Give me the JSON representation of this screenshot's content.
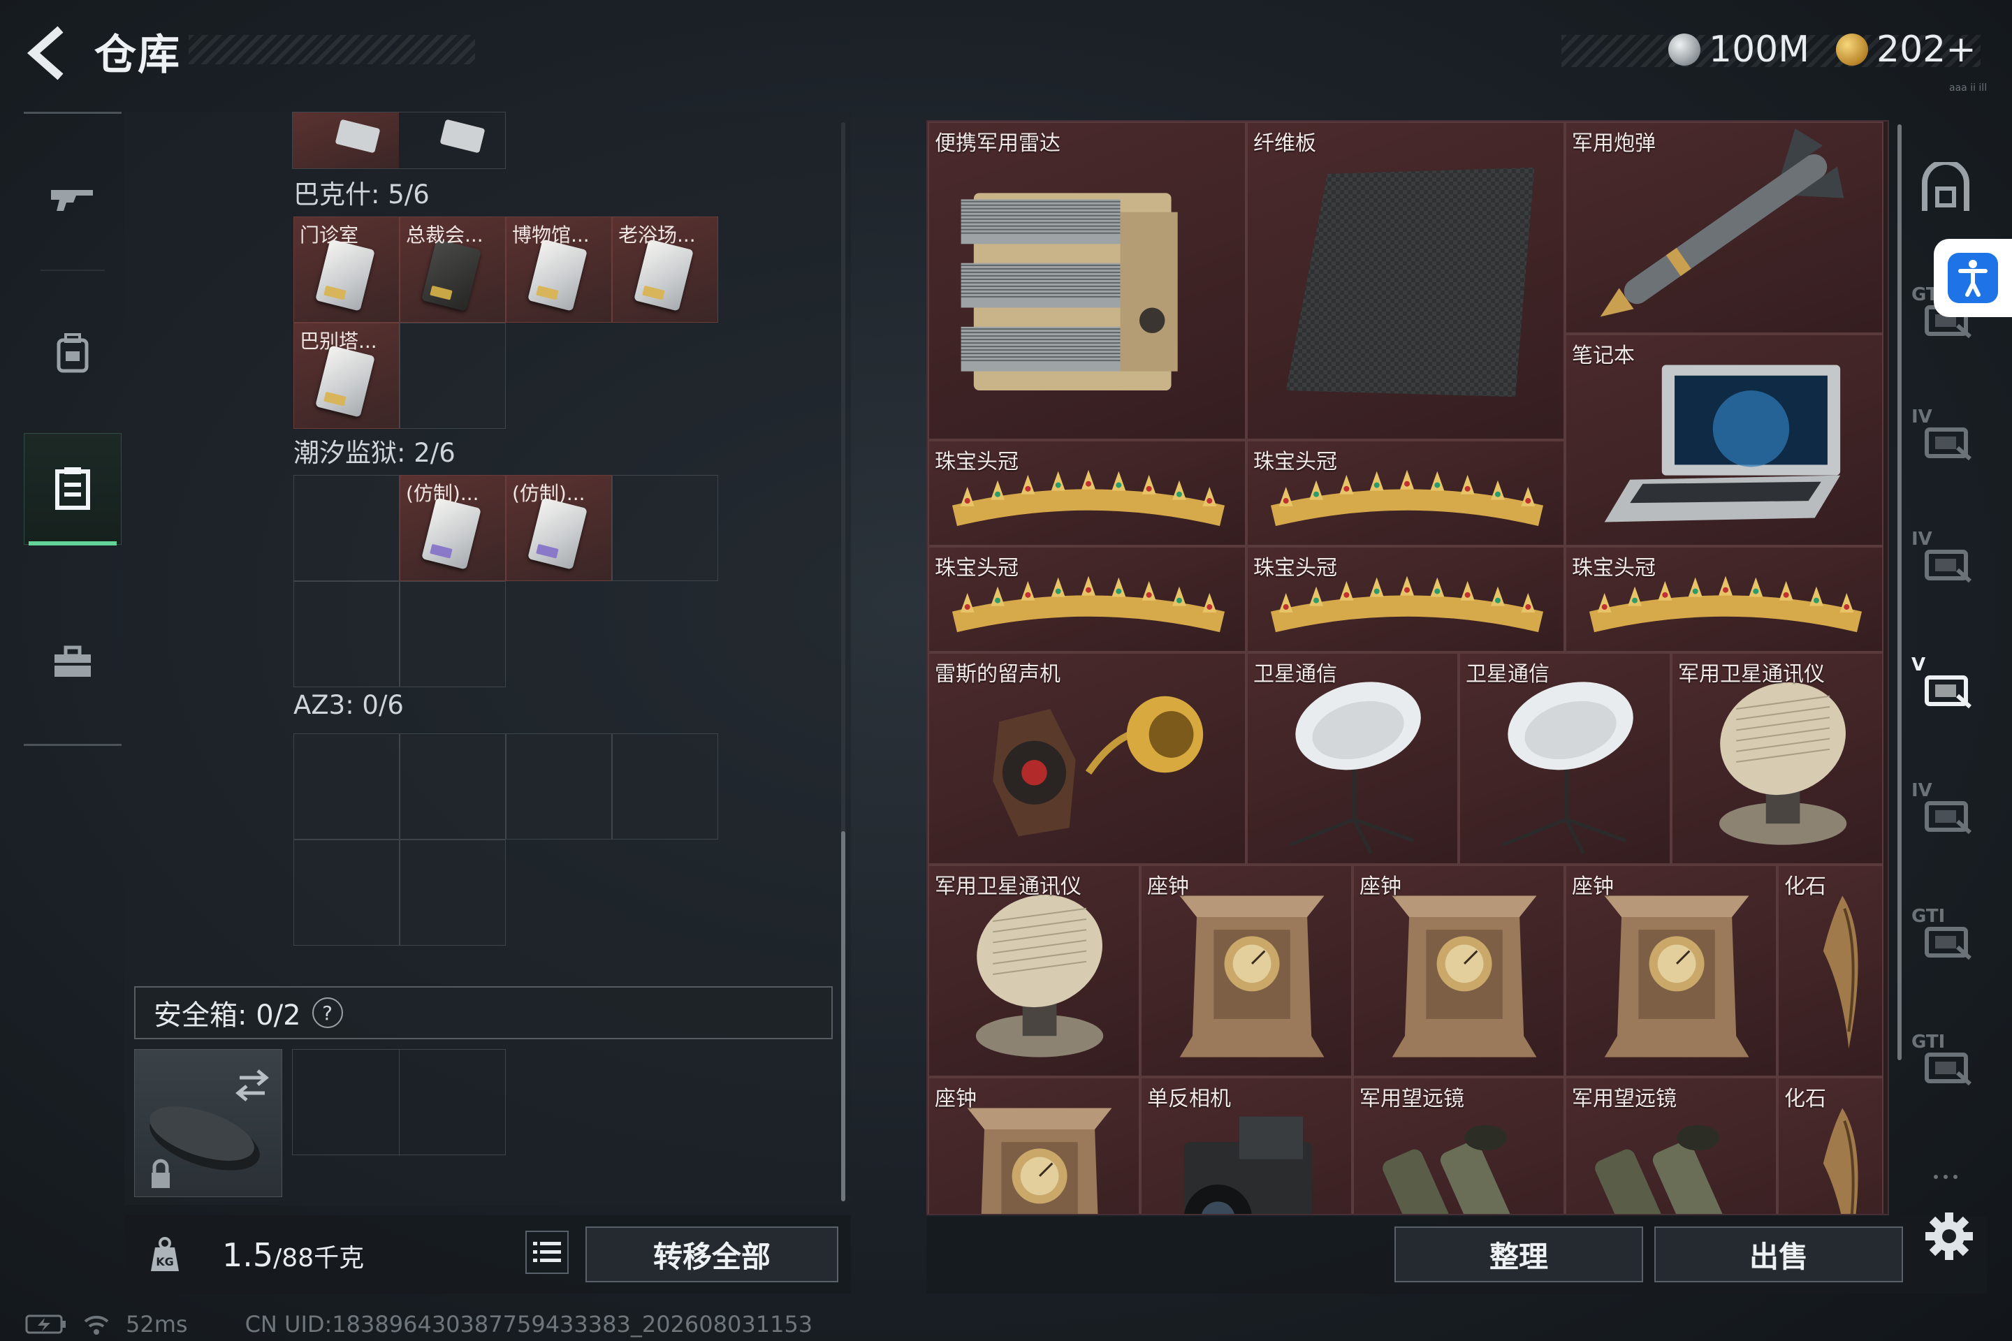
{
  "header": {
    "title": "仓库",
    "currencies": [
      {
        "value": "100M",
        "icon": "silver-coin-icon",
        "color": "#c9ced2"
      },
      {
        "value": "202+",
        "icon": "gold-triangle-coin-icon",
        "color": "#d8a840"
      }
    ],
    "id_text": "aaa ii ill"
  },
  "left_rail": {
    "items": [
      {
        "icon": "rifle-icon"
      },
      {
        "icon": "backpack-icon"
      },
      {
        "icon": "warehouse-locker-icon",
        "active": true
      },
      {
        "icon": "toolbox-icon"
      }
    ]
  },
  "keycards": {
    "sections": [
      {
        "label": "巴克什: 5/6",
        "cells": [
          {
            "name": "门诊室",
            "card": "white"
          },
          {
            "name": "总裁会...",
            "card": "black"
          },
          {
            "name": "博物馆...",
            "card": "white"
          },
          {
            "name": "老浴场...",
            "card": "white"
          },
          {
            "name": "巴别塔...",
            "card": "white"
          },
          {
            "name": "",
            "card": ""
          }
        ]
      },
      {
        "label": "潮汐监狱: 2/6",
        "cells": [
          {
            "name": "",
            "card": ""
          },
          {
            "name": "(仿制)...",
            "card": "purple"
          },
          {
            "name": "(仿制)...",
            "card": "purple"
          },
          {
            "name": "",
            "card": ""
          },
          {
            "name": "",
            "card": ""
          },
          {
            "name": "",
            "card": ""
          }
        ]
      },
      {
        "label": "AZ3: 0/6",
        "cells": [
          {
            "name": "",
            "card": ""
          },
          {
            "name": "",
            "card": ""
          },
          {
            "name": "",
            "card": ""
          },
          {
            "name": "",
            "card": ""
          },
          {
            "name": "",
            "card": ""
          },
          {
            "name": "",
            "card": ""
          }
        ]
      }
    ]
  },
  "safe_box": {
    "label": "安全箱:  0/2",
    "help": "?"
  },
  "weight": {
    "current": "1.5",
    "max": "/88千克"
  },
  "buttons": {
    "transfer_all": "转移全部",
    "sort": "整理",
    "sell": "出售"
  },
  "stash_items": [
    {
      "name": "便携军用雷达",
      "art": "radar"
    },
    {
      "name": "纤维板",
      "art": "carbon"
    },
    {
      "name": "军用炮弹",
      "art": "missile"
    },
    {
      "name": "笔记本",
      "art": "laptop"
    },
    {
      "name": "珠宝头冠",
      "art": "tiara"
    },
    {
      "name": "珠宝头冠",
      "art": "tiara"
    },
    {
      "name": "珠宝头冠",
      "art": "tiara"
    },
    {
      "name": "珠宝头冠",
      "art": "tiara"
    },
    {
      "name": "珠宝头冠",
      "art": "tiara"
    },
    {
      "name": "雷斯的留声机",
      "art": "gramophone"
    },
    {
      "name": "卫星通信",
      "art": "dish"
    },
    {
      "name": "卫星通信",
      "art": "dish"
    },
    {
      "name": "军用卫星通讯仪",
      "art": "satcom"
    },
    {
      "name": "军用卫星通讯仪",
      "art": "satcom"
    },
    {
      "name": "座钟",
      "art": "clock"
    },
    {
      "name": "座钟",
      "art": "clock"
    },
    {
      "name": "座钟",
      "art": "clock"
    },
    {
      "name": "化石",
      "art": "fossil"
    },
    {
      "name": "座钟",
      "art": "clock"
    },
    {
      "name": "单反相机",
      "art": "camera"
    },
    {
      "name": "军用望远镜",
      "art": "binoculars"
    },
    {
      "name": "军用望远镜",
      "art": "binoculars"
    },
    {
      "name": "化石",
      "art": "fossil"
    }
  ],
  "right_rail": {
    "items": [
      {
        "icon": "vault-icon",
        "tag": ""
      },
      {
        "icon": "storage-gti-icon",
        "tag": "GTI"
      },
      {
        "icon": "folder-iv-icon",
        "tag": "IV"
      },
      {
        "icon": "medkit-iv-icon",
        "tag": "IV"
      },
      {
        "icon": "case-v-icon",
        "tag": "V"
      },
      {
        "icon": "ammo-iv-icon",
        "tag": "IV"
      },
      {
        "icon": "container-gti-icon",
        "tag": "GTI"
      },
      {
        "icon": "container-gti2-icon",
        "tag": "GTI"
      },
      {
        "icon": "more-icon",
        "tag": "..."
      }
    ]
  },
  "status": {
    "ping": "52ms",
    "uid": "CN UID:18389643038775943338​3_202608031153"
  }
}
